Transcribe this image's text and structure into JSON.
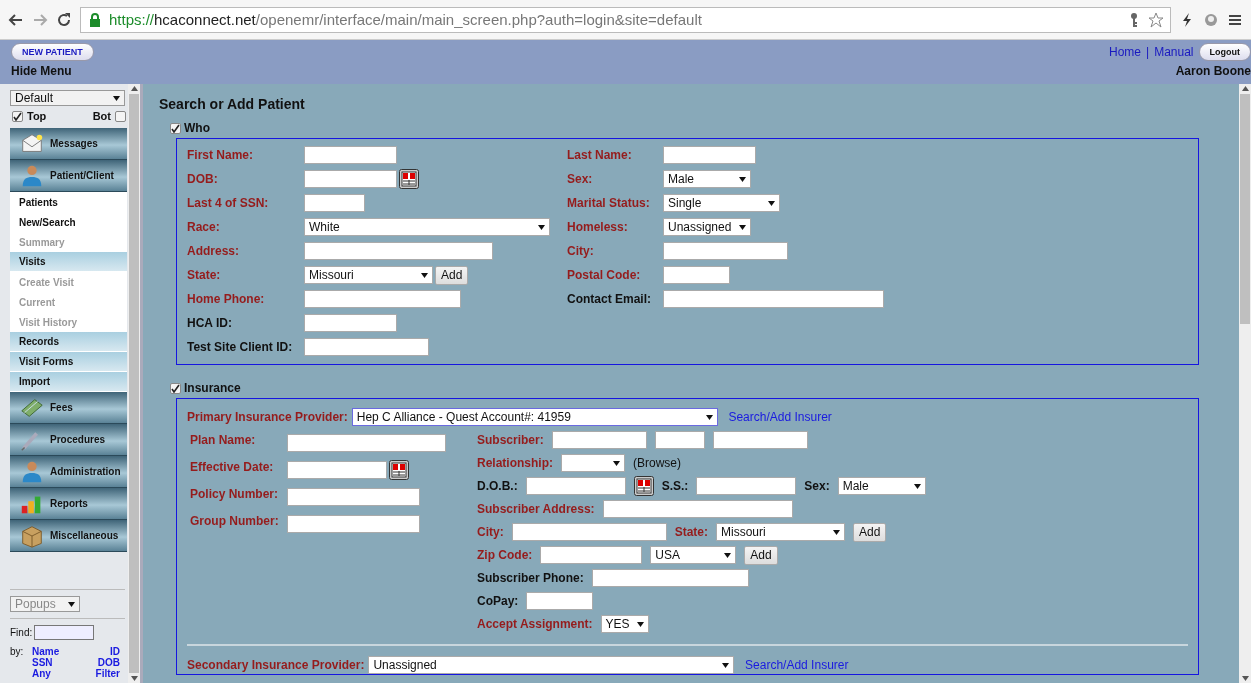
{
  "browser": {
    "url": {
      "scheme": "https://",
      "host": "hcaconnect.net",
      "path": "/openemr/interface/main/main_screen.php?auth=login&site=default"
    }
  },
  "header": {
    "new_patient": "NEW PATIENT",
    "hide_menu": "Hide Menu",
    "links": [
      "Home",
      "Manual"
    ],
    "separator": "|",
    "logout": "Logout",
    "user": "Aaron Boone"
  },
  "sidebar": {
    "view_select": "Default",
    "top": {
      "label": "Top",
      "checked": true
    },
    "bot": {
      "label": "Bot",
      "checked": false
    },
    "menu": [
      {
        "kind": "main",
        "label": "Messages"
      },
      {
        "kind": "main",
        "label": "Patient/Client"
      },
      {
        "kind": "sub",
        "label": "Patients",
        "disabled": false
      },
      {
        "kind": "sub",
        "label": "New/Search",
        "disabled": false
      },
      {
        "kind": "sub",
        "label": "Summary",
        "disabled": true
      },
      {
        "kind": "section",
        "label": "Visits"
      },
      {
        "kind": "sub",
        "label": "Create Visit",
        "disabled": true
      },
      {
        "kind": "sub",
        "label": "Current",
        "disabled": true
      },
      {
        "kind": "sub",
        "label": "Visit History",
        "disabled": true
      },
      {
        "kind": "section",
        "label": "Records"
      },
      {
        "kind": "section",
        "label": "Visit Forms"
      },
      {
        "kind": "section",
        "label": "Import"
      },
      {
        "kind": "main",
        "label": "Fees"
      },
      {
        "kind": "main",
        "label": "Procedures"
      },
      {
        "kind": "main",
        "label": "Administration"
      },
      {
        "kind": "main",
        "label": "Reports"
      },
      {
        "kind": "main",
        "label": "Miscellaneous"
      }
    ],
    "popups": "Popups",
    "find_label": "Find:",
    "by_label": "by:",
    "find_links": [
      "Name",
      "ID",
      "SSN",
      "DOB",
      "Any",
      "Filter"
    ]
  },
  "page_title": "Search or Add Patient",
  "who": {
    "label": "Who",
    "checked": true,
    "rows": [
      {
        "left": {
          "label": "First Name:",
          "required": true,
          "control": {
            "kind": "text"
          }
        },
        "right": {
          "label": "Last Name:",
          "required": true,
          "control": {
            "kind": "text"
          }
        }
      },
      {
        "left": {
          "label": "DOB:",
          "required": true,
          "control": {
            "kind": "date"
          }
        },
        "right": {
          "label": "Sex:",
          "required": true,
          "control": {
            "kind": "select",
            "value": "Male"
          }
        }
      },
      {
        "left": {
          "label": "Last 4 of SSN:",
          "required": true,
          "control": {
            "kind": "text"
          }
        },
        "right": {
          "label": "Marital Status:",
          "required": true,
          "control": {
            "kind": "select",
            "value": "Single"
          }
        }
      },
      {
        "left": {
          "label": "Race:",
          "required": true,
          "control": {
            "kind": "select",
            "value": "White"
          }
        },
        "right": {
          "label": "Homeless:",
          "required": true,
          "control": {
            "kind": "select",
            "value": "Unassigned"
          }
        }
      },
      {
        "left": {
          "label": "Address:",
          "required": true,
          "control": {
            "kind": "text"
          }
        },
        "right": {
          "label": "City:",
          "required": true,
          "control": {
            "kind": "text"
          }
        }
      },
      {
        "left": {
          "label": "State:",
          "required": true,
          "control": {
            "kind": "select_add",
            "value": "Missouri",
            "button": "Add"
          }
        },
        "right": {
          "label": "Postal Code:",
          "required": true,
          "control": {
            "kind": "text"
          }
        }
      },
      {
        "left": {
          "label": "Home Phone:",
          "required": true,
          "control": {
            "kind": "text"
          }
        },
        "right": {
          "label": "Contact Email:",
          "required": false,
          "control": {
            "kind": "text"
          }
        }
      },
      {
        "left": {
          "label": "HCA ID:",
          "required": false,
          "control": {
            "kind": "text"
          }
        }
      },
      {
        "left": {
          "label": "Test Site Client ID:",
          "required": false,
          "control": {
            "kind": "text"
          }
        }
      }
    ]
  },
  "insurance": {
    "label": "Insurance",
    "checked": true,
    "primary": {
      "label": "Primary Insurance Provider:",
      "value": "Hep C Alliance - Quest Account#: 41959",
      "link": "Search/Add Insurer"
    },
    "left_rows": [
      {
        "label": "Plan Name:",
        "required": true,
        "control": {
          "kind": "text"
        }
      },
      {
        "label": "Effective Date:",
        "required": true,
        "control": {
          "kind": "date"
        }
      },
      {
        "label": "Policy Number:",
        "required": true,
        "control": {
          "kind": "text"
        }
      },
      {
        "label": "Group Number:",
        "required": true,
        "control": {
          "kind": "text"
        }
      }
    ],
    "right_rows": [
      [
        {
          "kind": "label",
          "text": "Subscriber:",
          "required": true
        },
        {
          "kind": "text"
        },
        {
          "kind": "text"
        },
        {
          "kind": "text"
        }
      ],
      [
        {
          "kind": "label",
          "text": "Relationship:",
          "required": true
        },
        {
          "kind": "select"
        },
        {
          "kind": "note",
          "text": "(Browse)"
        }
      ],
      [
        {
          "kind": "label",
          "text": "D.O.B.:",
          "required": false
        },
        {
          "kind": "text"
        },
        {
          "kind": "date"
        },
        {
          "kind": "label",
          "text": "S.S.:",
          "required": false
        },
        {
          "kind": "text"
        },
        {
          "kind": "label",
          "text": "Sex:",
          "required": false
        },
        {
          "kind": "select",
          "value": "Male"
        }
      ],
      [
        {
          "kind": "label",
          "text": "Subscriber Address:",
          "required": true
        },
        {
          "kind": "text"
        }
      ],
      [
        {
          "kind": "label",
          "text": "City:",
          "required": true
        },
        {
          "kind": "text"
        },
        {
          "kind": "label",
          "text": "State:",
          "required": true
        },
        {
          "kind": "select",
          "value": "Missouri"
        },
        {
          "kind": "button",
          "text": "Add"
        }
      ],
      [
        {
          "kind": "label",
          "text": "Zip Code:",
          "required": true
        },
        {
          "kind": "text"
        },
        {
          "kind": "select",
          "value": "USA"
        },
        {
          "kind": "button",
          "text": "Add"
        }
      ],
      [
        {
          "kind": "label",
          "text": "Subscriber Phone:",
          "required": false
        },
        {
          "kind": "text"
        }
      ],
      [
        {
          "kind": "label",
          "text": "CoPay:",
          "required": false
        },
        {
          "kind": "text"
        }
      ],
      [
        {
          "kind": "label",
          "text": "Accept Assignment:",
          "required": true
        },
        {
          "kind": "select",
          "value": "YES"
        }
      ]
    ],
    "secondary": {
      "label": "Secondary Insurance Provider:",
      "value": "Unassigned",
      "link": "Search/Add Insurer"
    }
  }
}
